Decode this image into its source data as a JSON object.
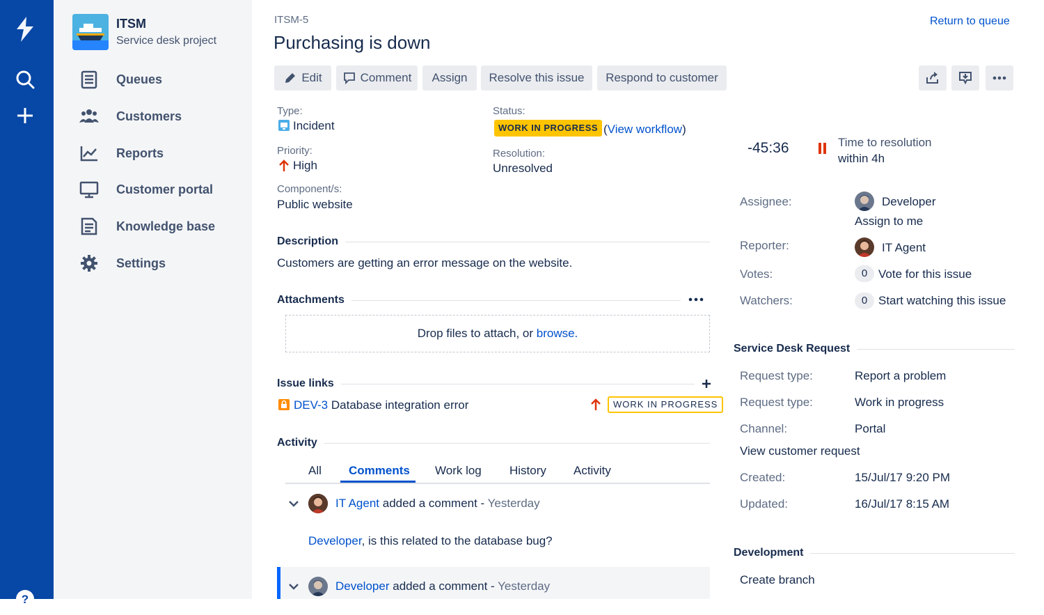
{
  "nav": {
    "icons": [
      "product-logo-icon",
      "search-icon",
      "create-icon",
      "help-icon"
    ]
  },
  "project": {
    "name": "ITSM",
    "type": "Service desk project",
    "items": [
      {
        "label": "Queues",
        "icon": "queues-icon"
      },
      {
        "label": "Customers",
        "icon": "customers-icon"
      },
      {
        "label": "Reports",
        "icon": "reports-icon"
      },
      {
        "label": "Customer portal",
        "icon": "customer-portal-icon"
      },
      {
        "label": "Knowledge base",
        "icon": "knowledge-base-icon"
      },
      {
        "label": "Settings",
        "icon": "settings-icon"
      }
    ]
  },
  "issue": {
    "key": "ITSM-5",
    "title": "Purchasing is down",
    "return_link": "Return to queue"
  },
  "toolbar": {
    "edit": "Edit",
    "comment": "Comment",
    "assign": "Assign",
    "resolve": "Resolve this issue",
    "respond": "Respond to customer"
  },
  "details": {
    "type_label": "Type:",
    "type_value": "Incident",
    "priority_label": "Priority:",
    "priority_value": "High",
    "component_label": "Component/s:",
    "component_value": "Public website",
    "status_label": "Status:",
    "status_value": "WORK IN PROGRESS",
    "view_workflow_open": "(",
    "view_workflow": "View workflow",
    "view_workflow_close": ")",
    "resolution_label": "Resolution:",
    "resolution_value": "Unresolved"
  },
  "description": {
    "heading": "Description",
    "text": "Customers are getting an error message on the website."
  },
  "attachments": {
    "heading": "Attachments",
    "drop_text": "Drop files to attach, or ",
    "browse": "browse."
  },
  "issue_links": {
    "heading": "Issue links",
    "link_key": "DEV-3",
    "link_summary": "Database integration error",
    "link_status": "WORK IN PROGRESS"
  },
  "activity": {
    "heading": "Activity",
    "tabs": [
      "All",
      "Comments",
      "Work log",
      "History",
      "Activity"
    ],
    "comments": [
      {
        "author": "IT Agent",
        "action": "added a comment - ",
        "time": "Yesterday",
        "mention": "Developer",
        "body": ", is this related to the database bug?"
      },
      {
        "author": "Developer",
        "action": "added a comment - ",
        "time": "Yesterday"
      }
    ]
  },
  "sla": {
    "time": "-45:36",
    "label": "Time to resolution",
    "goal": "within 4h"
  },
  "people": {
    "assignee_label": "Assignee:",
    "assignee": "Developer",
    "assign_to_me": "Assign to me",
    "reporter_label": "Reporter:",
    "reporter": "IT Agent",
    "votes_label": "Votes:",
    "votes_count": "0",
    "vote_link": "Vote for this issue",
    "watchers_label": "Watchers:",
    "watchers_count": "0",
    "watch_link": "Start watching this issue"
  },
  "sd_request": {
    "heading": "Service Desk Request",
    "rows": [
      {
        "label": "Request type:",
        "value": "Report a problem"
      },
      {
        "label": "Request type:",
        "value": "Work in progress"
      },
      {
        "label": "Channel:",
        "value": "Portal"
      }
    ],
    "view_link": "View customer request",
    "created_label": "Created:",
    "created": "15/Jul/17 9:20 PM",
    "updated_label": "Updated:",
    "updated": "16/Jul/17 8:15 AM"
  },
  "development": {
    "heading": "Development",
    "create_branch": "Create branch"
  },
  "colors": {
    "nav": "#0747a6",
    "sidebar": "#f4f5f7",
    "link": "#0052cc",
    "lozenge": "#ffc400",
    "priority_high": "#de350b"
  }
}
